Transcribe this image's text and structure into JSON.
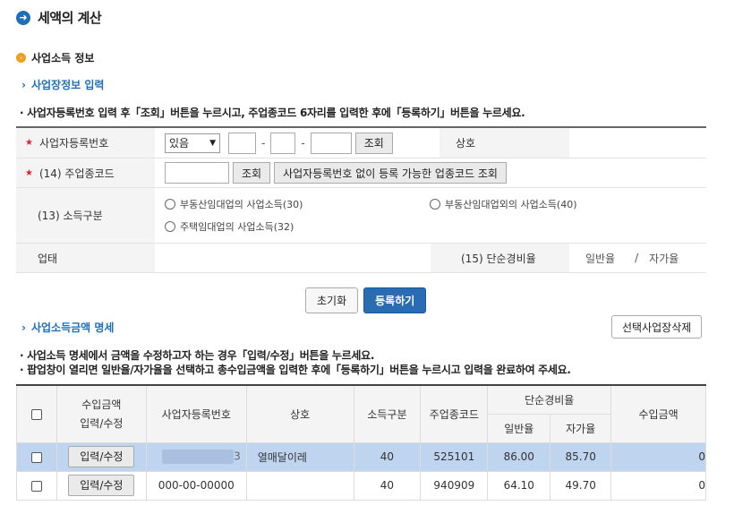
{
  "page": {
    "title": "세액의 계산"
  },
  "section": {
    "title": "사업소득 정보"
  },
  "business_info": {
    "subtitle": "사업장정보 입력",
    "notice": "· 사업자등록번호 입력 후「조회」버튼을 누르시고, 주업종코드 6자리를 입력한 후에「등록하기」버튼을 누르세요.",
    "fields": {
      "biz_no_label": "사업자등록번호",
      "biz_no_select_value": "있음",
      "lookup_label": "조회",
      "company_label": "상호",
      "industry_code_label": "(14) 주업종코드",
      "lookup2_label": "조회",
      "industry_lookup_label": "사업자등록번호 없이 등록 가능한 업종코드 조회",
      "income_type_label": "(13) 소득구분",
      "income_options": [
        "부동산임대업의 사업소득(30)",
        "부동산임대업외의 사업소득(40)",
        "주택임대업의 사업소득(32)"
      ],
      "business_type_label": "업태",
      "expense_rate_label": "(15) 단순경비율",
      "expense_rate_general": "일반율",
      "expense_rate_sep": "/",
      "expense_rate_self": "자가율"
    },
    "buttons": {
      "reset": "초기화",
      "register": "등록하기"
    }
  },
  "income_details": {
    "subtitle": "사업소득금액 명세",
    "delete_button": "선택사업장삭제",
    "notices": [
      "· 사업소득 명세에서 금액을 수정하고자 하는 경우「입력/수정」버튼을 누르세요.",
      "· 팝업창이 열리면 일반율/자가율을 선택하고 총수입금액을 입력한 후에「등록하기」버튼을 누르시고 입력을 완료하여 주세요."
    ],
    "columns": {
      "income_edit_1": "수입금액",
      "income_edit_2": "입력/수정",
      "biz_no": "사업자등록번호",
      "company": "상호",
      "income_type": "소득구분",
      "industry_code": "주업종코드",
      "expense_rate": "단순경비율",
      "general_rate": "일반율",
      "self_rate": "자가율",
      "revenue": "수입금액"
    },
    "rows": [
      {
        "edit": "입력/수정",
        "biz_no": "3",
        "company": "열매달이레",
        "income_type": "40",
        "industry_code": "525101",
        "general_rate": "86.00",
        "self_rate": "85.70",
        "revenue": "0"
      },
      {
        "edit": "입력/수정",
        "biz_no": "000-00-00000",
        "company": "",
        "income_type": "40",
        "industry_code": "940909",
        "general_rate": "64.10",
        "self_rate": "49.70",
        "revenue": "0"
      }
    ]
  }
}
